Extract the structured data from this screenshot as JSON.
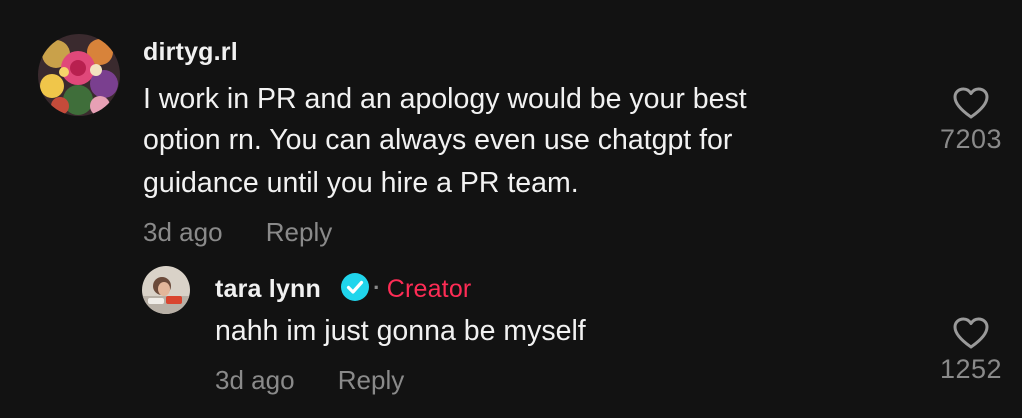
{
  "comment": {
    "username": "dirtyg.rl",
    "text_lines": [
      "I work in PR and an apology would be your best",
      "option rn. You can always even use chatgpt for",
      "guidance until you hire a PR team."
    ],
    "time": "3d ago",
    "reply_label": "Reply",
    "like_count": "7203",
    "avatar_icon": "flower-bouquet-avatar"
  },
  "reply": {
    "username": "tara lynn",
    "verified_icon": "verified-check-icon",
    "creator_label": "Creator",
    "text": "nahh im just gonna be myself",
    "time": "3d ago",
    "reply_label": "Reply",
    "like_count": "1252",
    "avatar_icon": "user-photo-avatar"
  },
  "colors": {
    "background": "#121212",
    "text": "#f2f2f2",
    "muted": "#8a8a8a",
    "creator": "#fe2c55",
    "verified": "#20d5ec"
  }
}
